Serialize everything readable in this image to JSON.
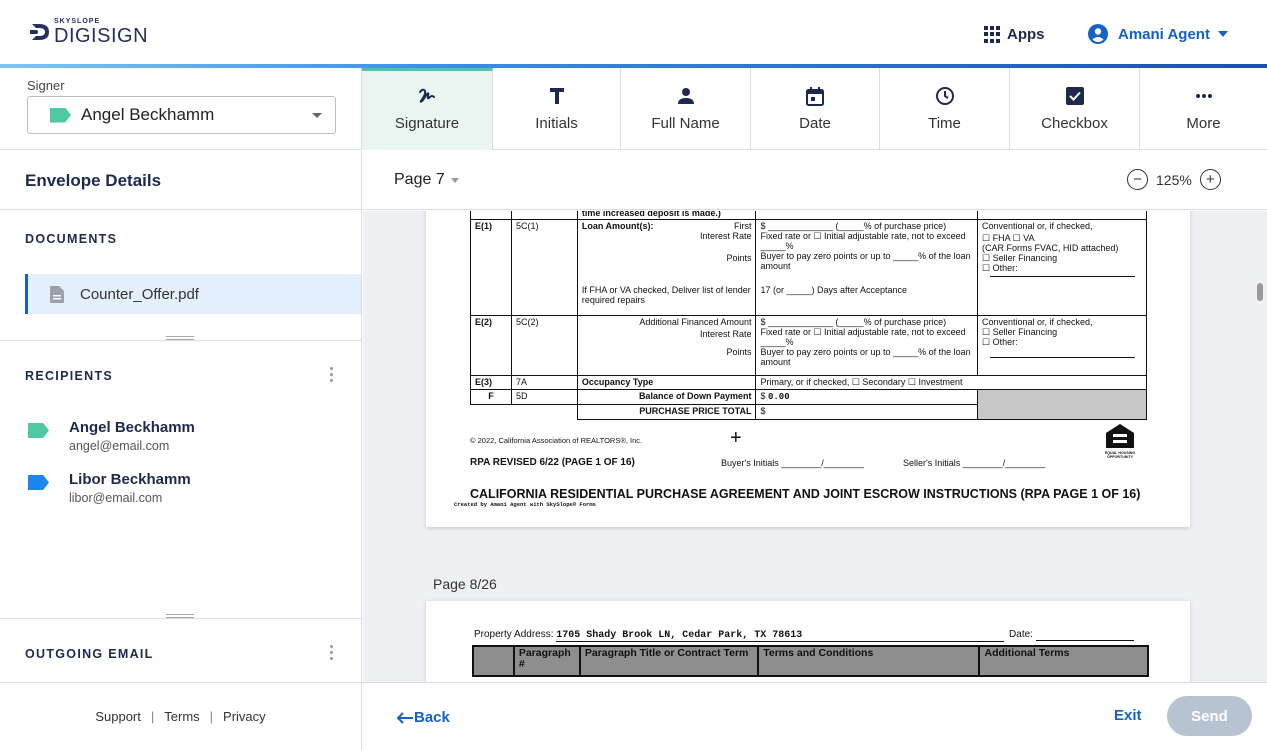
{
  "brand": {
    "small": "SKYSLOPE",
    "big": "DIGISIGN"
  },
  "header": {
    "apps_label": "Apps",
    "user_name": "Amani Agent"
  },
  "signer": {
    "label": "Signer",
    "name": "Angel Beckhamm"
  },
  "tools": [
    {
      "label": "Signature",
      "icon": "signature-icon"
    },
    {
      "label": "Initials",
      "icon": "initials-icon"
    },
    {
      "label": "Full Name",
      "icon": "person-icon"
    },
    {
      "label": "Date",
      "icon": "calendar-icon"
    },
    {
      "label": "Time",
      "icon": "clock-icon"
    },
    {
      "label": "Checkbox",
      "icon": "checkbox-icon"
    },
    {
      "label": "More",
      "icon": "more-icon"
    }
  ],
  "sidebar": {
    "title": "Envelope Details",
    "documents_label": "DOCUMENTS",
    "document": "Counter_Offer.pdf",
    "recipients_label": "RECIPIENTS",
    "recipients": [
      {
        "name": "Angel Beckhamm",
        "email": "angel@email.com",
        "color": "#4ec9a4"
      },
      {
        "name": "Libor Beckhamm",
        "email": "libor@email.com",
        "color": "#1b86ef"
      }
    ],
    "outgoing_label": "OUTGOING EMAIL"
  },
  "viewer": {
    "page_selector": "Page 7",
    "zoom": "125%",
    "page8_label": "Page 8/26"
  },
  "doc": {
    "top_text": "time increased deposit is made.)",
    "rows": {
      "e1_code": "E(1)",
      "e1_para": "5C(1)",
      "e1_title": "Loan Amount(s):",
      "e1_first": "First",
      "e1_ir": "Interest Rate",
      "e1_points": "Points",
      "e1_fha": "If FHA or VA checked, Deliver list of lender required repairs",
      "e1_terms1": "$ _____________ (_____% of purchase price)",
      "e1_terms2": "Fixed rate or ☐ Initial adjustable rate, not to exceed _____%",
      "e1_terms3": "Buyer to pay zero points or up to _____% of the loan amount",
      "e1_terms4": "17 (or _____) Days after Acceptance",
      "e1_add1": "Conventional or, if checked,",
      "e1_add2": "☐ FHA ☐ VA",
      "e1_add3": "(CAR Forms FVAC, HID attached)",
      "e1_add4": "☐ Seller Financing",
      "e1_add5": "☐ Other:",
      "e2_code": "E(2)",
      "e2_para": "5C(2)",
      "e2_title": "Additional Financed Amount",
      "e2_ir": "Interest Rate",
      "e2_points": "Points",
      "e2_terms1": "$ _____________ (_____% of purchase price)",
      "e2_terms2": "Fixed rate or ☐ Initial adjustable rate, not to exceed _____%",
      "e2_terms3": "Buyer to pay zero points or up to _____% of the loan amount",
      "e2_add1": "Conventional or, if checked,",
      "e2_add2": "☐ Seller Financing",
      "e2_add3": "☐ Other:",
      "e3_code": "E(3)",
      "e3_para": "7A",
      "e3_title": "Occupancy Type",
      "e3_terms": "Primary, or if checked, ☐ Secondary ☐ Investment",
      "f_code": "F",
      "f_para": "5D",
      "f_title": "Balance of Down Payment",
      "f_value": "0.00",
      "total_title": "PURCHASE PRICE TOTAL",
      "dollar": "$"
    },
    "copyright": "© 2022, California Association of REALTORS®, Inc.",
    "rpa_rev": "RPA REVISED 6/22 (PAGE 1 OF 16)",
    "buyer_init": "Buyer's Initials ________/________",
    "seller_init": "Seller's Initials ________/________",
    "eho": "EQUAL HOUSING OPPORTUNITY",
    "footer_title": "CALIFORNIA RESIDENTIAL PURCHASE AGREEMENT AND JOINT ESCROW INSTRUCTIONS (RPA PAGE 1 OF 16)",
    "created_by": "Created by Amani Agent with SkySlope® Forms",
    "prop_label": "Property Address:",
    "prop_value": "1705 Shady Brook LN, Cedar Park, TX 78613",
    "date_label": "Date:",
    "hdr_para": "Paragraph #",
    "hdr_title": "Paragraph Title or Contract Term",
    "hdr_terms": "Terms and Conditions",
    "hdr_add": "Additional Terms"
  },
  "footer": {
    "support": "Support",
    "terms": "Terms",
    "privacy": "Privacy",
    "back": "Back",
    "exit": "Exit",
    "send": "Send"
  }
}
